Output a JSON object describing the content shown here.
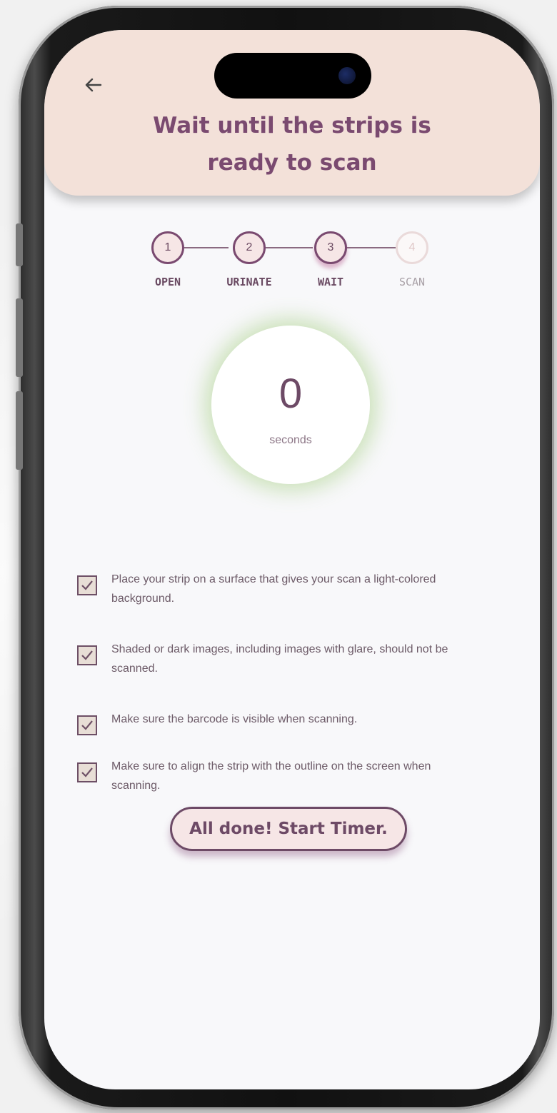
{
  "header": {
    "back_icon": "arrow-left-icon",
    "title_line1": "Wait until the strips is",
    "title_line2": "ready to scan"
  },
  "stepper": {
    "steps": [
      {
        "number": "1",
        "label": "OPEN",
        "state": "done"
      },
      {
        "number": "2",
        "label": "URINATE",
        "state": "done"
      },
      {
        "number": "3",
        "label": "WAIT",
        "state": "current"
      },
      {
        "number": "4",
        "label": "SCAN",
        "state": "upcoming"
      }
    ]
  },
  "timer": {
    "value": "0",
    "unit": "seconds"
  },
  "checklist": {
    "items": [
      {
        "text": "Place your strip on a surface that gives your scan a light-colored background.",
        "checked": true
      },
      {
        "text": "Shaded or dark images, including images with glare, should not be scanned.",
        "checked": true
      },
      {
        "text": "Make sure the barcode is visible when scanning.",
        "checked": true
      },
      {
        "text": "Make sure to align the strip with the outline on the screen when scanning.",
        "checked": true
      }
    ]
  },
  "cta": {
    "label": "All done! Start Timer."
  },
  "colors": {
    "header_bg": "#f3e1d9",
    "accent": "#7a4a70",
    "timer_glow": "#96c86e",
    "screen_bg": "#f8f8fa"
  }
}
